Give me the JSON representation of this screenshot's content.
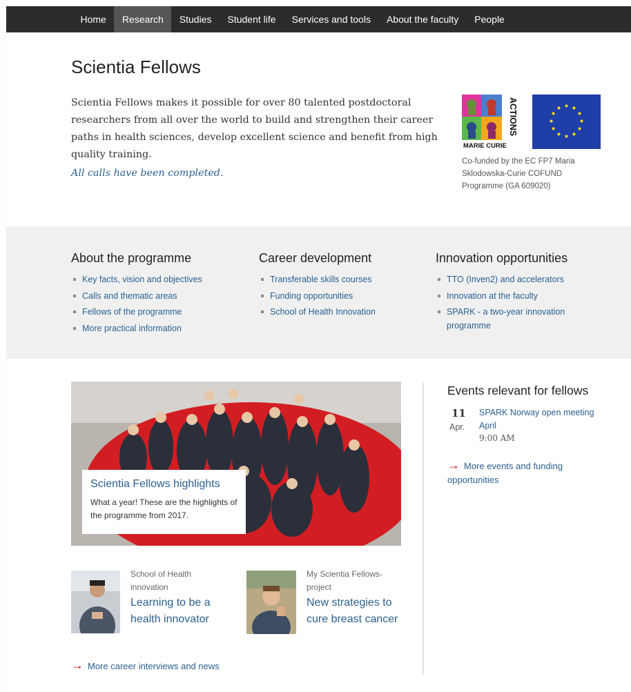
{
  "nav": {
    "items": [
      "Home",
      "Research",
      "Studies",
      "Student life",
      "Services and tools",
      "About the faculty",
      "People"
    ],
    "active_index": 1
  },
  "page": {
    "title": "Scientia Fellows",
    "intro": "Scientia Fellows makes it possible for over 80 talented postdoctoral researchers from all over the world to build and strengthen their career paths in health sciences, develop excellent science and benefit from high quality training.",
    "calls_link": "All calls have been completed",
    "calls_suffix": "."
  },
  "eu": {
    "logo_text_vertical": "ACTIONS",
    "logo_text_bottom": "MARIE CURIE",
    "caption": "Co-funded by the EC FP7 Maria Sklodowska-Curie COFUND Programme (GA 609020)"
  },
  "sections": [
    {
      "heading": "About the programme",
      "links": [
        "Key facts, vision and objectives",
        "Calls and thematic areas",
        "Fellows of the programme",
        "More practical information"
      ]
    },
    {
      "heading": "Career development",
      "links": [
        "Transferable skills courses",
        "Funding opportunities",
        "School of Health Innovation"
      ]
    },
    {
      "heading": "Innovation opportunities",
      "links": [
        "TTO (Inven2) and accelerators",
        "Innovation at the faculty",
        "SPARK - a two-year innovation programme"
      ]
    }
  ],
  "highlight": {
    "title": "Scientia Fellows highlights",
    "desc": "What a year! These are the highlights of the programme from 2017."
  },
  "stories": [
    {
      "category": "School of Health innovation",
      "title": "Learning to be a health innovator"
    },
    {
      "category": "My Scientia Fellows-project",
      "title": "New strategies to cure breast cancer"
    }
  ],
  "more_news": "More career interviews and news",
  "events": {
    "heading": "Events relevant for fellows",
    "items": [
      {
        "day": "11",
        "month": "Apr.",
        "name": "SPARK Norway open meeting April",
        "time": "9:00 AM"
      }
    ],
    "more": "More events and funding opportunities"
  },
  "colors": {
    "link": "#2b5f8f",
    "nav_bg": "#2c2c2c",
    "arrow": "#e00000",
    "band": "#f0f0f0"
  }
}
